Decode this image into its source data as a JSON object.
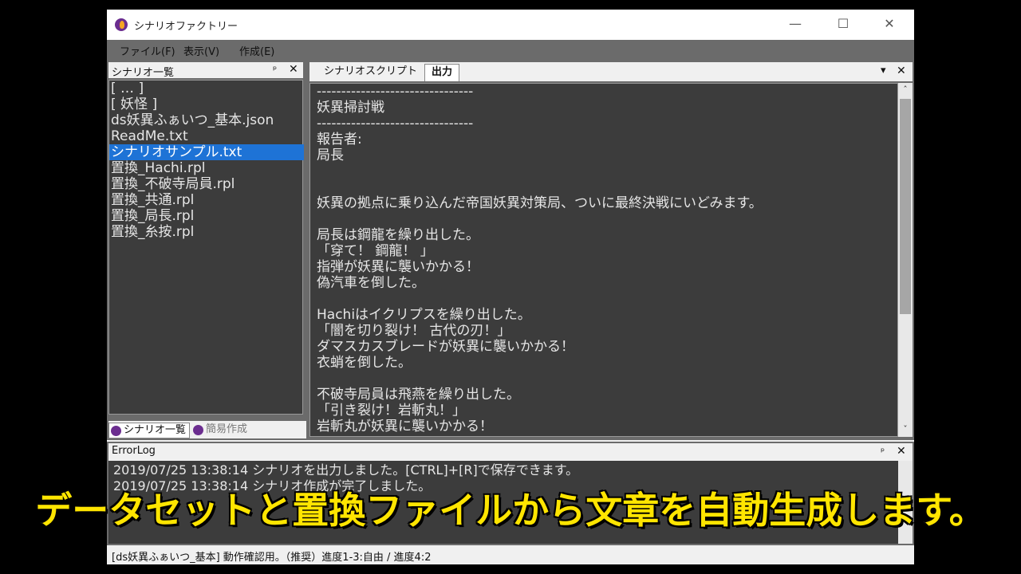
{
  "window": {
    "title": "シナリオファクトリー",
    "minimize": "—",
    "maximize": "☐",
    "close": "✕"
  },
  "menu": {
    "file": "ファイル(F)",
    "view": "表示(V)",
    "create": "作成(E)"
  },
  "scenario_panel": {
    "title": "シナリオ一覧",
    "pin": "ᵖ",
    "close": "✕",
    "items": [
      "[ … ]",
      "[ 妖怪 ]",
      "ds妖異ふぁいつ_基本.json",
      "ReadMe.txt",
      "シナリオサンプル.txt",
      "置換_Hachi.rpl",
      "置換_不破寺局員.rpl",
      "置換_共通.rpl",
      "置換_局長.rpl",
      "置換_糸按.rpl"
    ],
    "selected_index": 4,
    "tabs": [
      "シナリオ一覧",
      "簡易作成"
    ]
  },
  "output_panel": {
    "tabs": [
      "シナリオスクリプト",
      "出力"
    ],
    "active_tab": "出力",
    "dropdown": "▾",
    "close": "✕",
    "lines": [
      "--------------------------------",
      "妖異掃討戦",
      "--------------------------------",
      "報告者:",
      "局長",
      "",
      "",
      "妖異の拠点に乗り込んだ帝国妖異対策局、ついに最終決戦にいどみます。",
      "",
      "局長は鋼龍を繰り出した。",
      "「穿て！ 鋼龍！ 」",
      "指弾が妖異に襲いかかる！",
      "偽汽車を倒した。",
      "",
      "Hachiはイクリプスを繰り出した。",
      "「闇を切り裂け！ 古代の刃！」",
      "ダマスカスブレードが妖異に襲いかかる！",
      "衣蛸を倒した。",
      "",
      "不破寺局員は飛燕を繰り出した。",
      "「引き裂け！岩斬丸！」",
      "岩斬丸が妖異に襲いかかる！"
    ],
    "scroll_up": "ˆ",
    "scroll_down": "ˇ"
  },
  "error_log": {
    "title": "ErrorLog",
    "pin": "ᵖ",
    "close": "✕",
    "lines": [
      "2019/07/25 13:38:14 シナリオを出力しました。[CTRL]+[R]で保存できます。",
      "2019/07/25 13:38:14 シナリオ作成が完了しました。"
    ]
  },
  "status_bar": {
    "text": "[ds妖異ふぁいつ_基本] 動作確認用。（推奨）進度1-3:自由 / 進度4:2"
  },
  "caption": {
    "text": "データセットと置換ファイルから文章を自動生成します。"
  },
  "colors": {
    "accent": "#1e73d6",
    "caption": "#ffe500",
    "panel_bg": "#3c3c3c"
  }
}
